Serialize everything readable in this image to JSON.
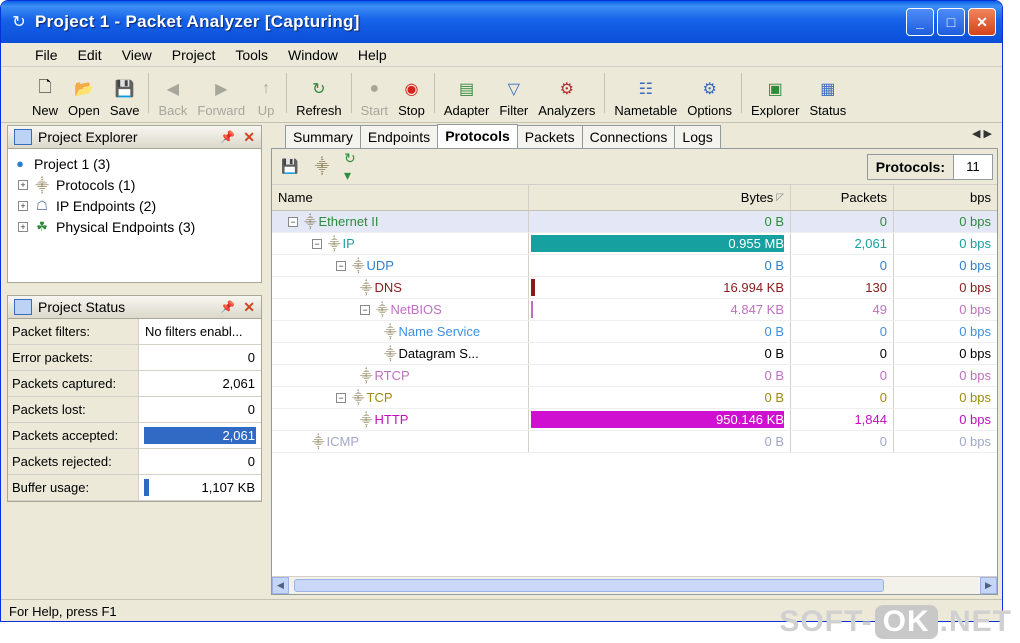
{
  "window": {
    "title": "Project 1 - Packet Analyzer [Capturing]"
  },
  "menu": [
    "File",
    "Edit",
    "View",
    "Project",
    "Tools",
    "Window",
    "Help"
  ],
  "toolbar": {
    "new": "New",
    "open": "Open",
    "save": "Save",
    "back": "Back",
    "forward": "Forward",
    "up": "Up",
    "refresh": "Refresh",
    "start": "Start",
    "stop": "Stop",
    "adapter": "Adapter",
    "filter": "Filter",
    "analyzers": "Analyzers",
    "nametable": "Nametable",
    "options": "Options",
    "explorer": "Explorer",
    "status": "Status"
  },
  "explorer": {
    "title": "Project Explorer",
    "root": "Project 1 (3)",
    "items": [
      "Protocols (1)",
      "IP Endpoints (2)",
      "Physical Endpoints (3)"
    ]
  },
  "status_panel": {
    "title": "Project Status",
    "rows": [
      {
        "label": "Packet filters:",
        "value": "No filters enabl..."
      },
      {
        "label": "Error packets:",
        "value": "0"
      },
      {
        "label": "Packets captured:",
        "value": "2,061"
      },
      {
        "label": "Packets lost:",
        "value": "0"
      },
      {
        "label": "Packets accepted:",
        "value": "2,061"
      },
      {
        "label": "Packets rejected:",
        "value": "0"
      },
      {
        "label": "Buffer usage:",
        "value": "1,107 KB"
      }
    ]
  },
  "tabs": [
    "Summary",
    "Endpoints",
    "Protocols",
    "Packets",
    "Connections",
    "Logs"
  ],
  "protocols_count": {
    "label": "Protocols:",
    "value": "11"
  },
  "grid": {
    "headers": {
      "name": "Name",
      "bytes": "Bytes",
      "packets": "Packets",
      "bps": "bps"
    },
    "rows": [
      {
        "name": "Ethernet II",
        "bytes": "0 B",
        "packets": "0",
        "bps": "0 bps",
        "color": "#2e8b3d"
      },
      {
        "name": "IP",
        "bytes": "0.955 MB",
        "packets": "2,061",
        "bps": "0 bps",
        "color": "#16a0a0"
      },
      {
        "name": "UDP",
        "bytes": "0 B",
        "packets": "0",
        "bps": "0 bps",
        "color": "#2f7fcf"
      },
      {
        "name": "DNS",
        "bytes": "16.994 KB",
        "packets": "130",
        "bps": "0 bps",
        "color": "#8b1a1a"
      },
      {
        "name": "NetBIOS",
        "bytes": "4.847 KB",
        "packets": "49",
        "bps": "0 bps",
        "color": "#c070c0"
      },
      {
        "name": "Name Service",
        "bytes": "0 B",
        "packets": "0",
        "bps": "0 bps",
        "color": "#3f8fdf"
      },
      {
        "name": "Datagram S...",
        "bytes": "0 B",
        "packets": "0",
        "bps": "0 bps",
        "color": "#000000"
      },
      {
        "name": "RTCP",
        "bytes": "0 B",
        "packets": "0",
        "bps": "0 bps",
        "color": "#c070c0"
      },
      {
        "name": "TCP",
        "bytes": "0 B",
        "packets": "0",
        "bps": "0 bps",
        "color": "#a08a10"
      },
      {
        "name": "HTTP",
        "bytes": "950.146 KB",
        "packets": "1,844",
        "bps": "0 bps",
        "color": "#c010c0"
      },
      {
        "name": "ICMP",
        "bytes": "0 B",
        "packets": "0",
        "bps": "0 bps",
        "color": "#a0a8c8"
      }
    ]
  },
  "statusbar": "For Help, press F1",
  "watermark": {
    "left": "SOFT-",
    "ok": "OK",
    "right": ".NET"
  }
}
